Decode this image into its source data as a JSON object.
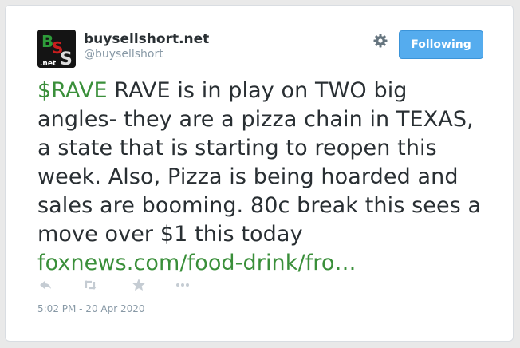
{
  "author": {
    "display_name": "buysellshort.net",
    "handle": "@buysellshort",
    "avatar_text": ".net",
    "avatar_letters": "BSS"
  },
  "follow_button": {
    "label": "Following"
  },
  "tweet": {
    "cashtag": "$RAVE",
    "body": " RAVE is in play on TWO big angles- they are a pizza chain in TEXAS, a state that is starting to reopen this week. Also, Pizza is being hoarded and sales are booming. 80c break this sees a move over $1 this today ",
    "link": "foxnews.com/food-drink/fro…"
  },
  "actions": {
    "reply_icon": "reply-icon",
    "retweet_icon": "retweet-icon",
    "favorite_icon": "star-icon",
    "more_icon": "more-icon"
  },
  "timestamp": "5:02 PM - 20 Apr 2020",
  "colors": {
    "accent_link": "#3a8f3a",
    "button_blue": "#55acee",
    "text": "#292f33",
    "muted": "#8899a6"
  }
}
